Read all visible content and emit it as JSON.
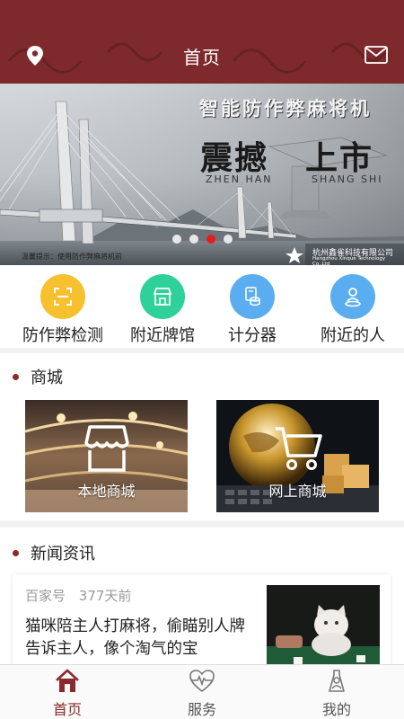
{
  "header": {
    "title": "首页",
    "location_icon": "location-pin-icon",
    "mail_icon": "mail-icon"
  },
  "banner": {
    "headline": "智能防作弊麻将机",
    "big_left": "震撼",
    "big_right": "上市",
    "pinyin_left": "ZHEN HAN",
    "pinyin_right": "SHANG SHI",
    "tip": "温馨提示：使用防作弊麻将机前",
    "company": "杭州鑫雀科技有限公司",
    "company_en": "Hangzhou Xinque Technology Co.,Ltd",
    "slide_count": 4,
    "active_slide": 3
  },
  "quick": [
    {
      "label": "防作弊检测",
      "icon": "scan-icon",
      "color": "#f6c02e"
    },
    {
      "label": "附近牌馆",
      "icon": "shop-icon",
      "color": "#2fd19a"
    },
    {
      "label": "计分器",
      "icon": "coins-icon",
      "color": "#5aaef0"
    },
    {
      "label": "附近的人",
      "icon": "person-location-icon",
      "color": "#5aaef0"
    }
  ],
  "mall": {
    "title": "商城",
    "cards": [
      {
        "label": "本地商城",
        "icon": "store-icon"
      },
      {
        "label": "网上商城",
        "icon": "cart-icon"
      }
    ]
  },
  "news": {
    "title": "新闻资讯",
    "items": [
      {
        "source": "百家号",
        "time": "377天前",
        "title": "猫咪陪主人打麻将，偷瞄别人牌告诉主人，像个淘气的宝"
      }
    ]
  },
  "tabbar": {
    "tabs": [
      {
        "label": "首页",
        "icon": "home-icon",
        "active": true
      },
      {
        "label": "服务",
        "icon": "heart-pulse-icon",
        "active": false
      },
      {
        "label": "我的",
        "icon": "user-icon",
        "active": false
      }
    ],
    "accent": "#8b2a2c"
  },
  "colors": {
    "header_bg": "#7e2a2c",
    "accent": "#8b2a2c",
    "dot_active": "#e02020"
  }
}
